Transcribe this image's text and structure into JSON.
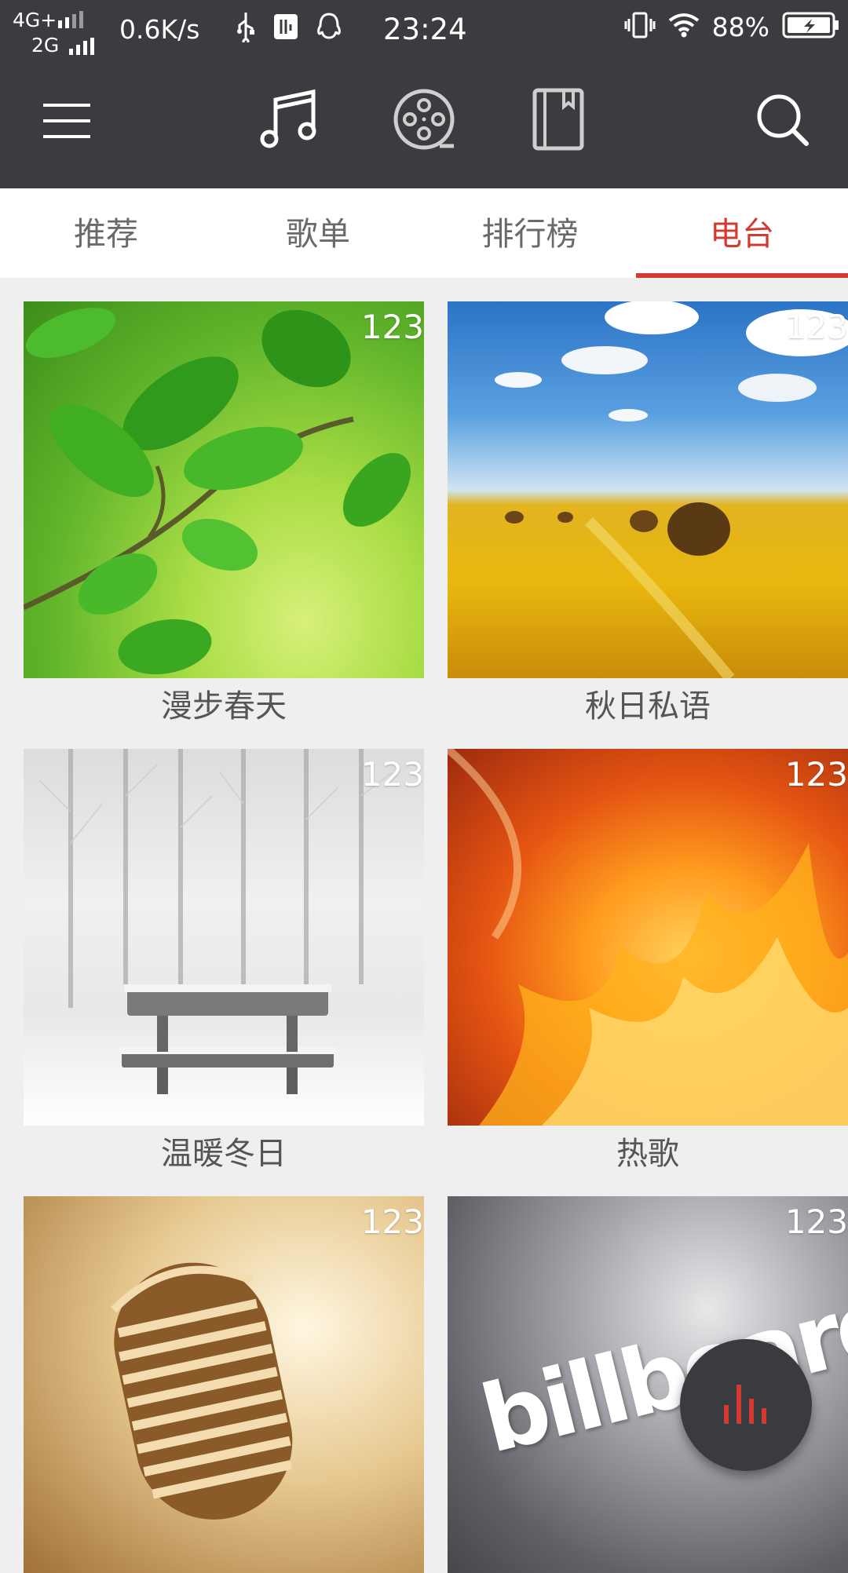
{
  "status_bar": {
    "network_top": "4G+",
    "network_bottom": "2G",
    "speed": "0.6K/s",
    "time": "23:24",
    "battery_percent": "88%",
    "icons": [
      "usb-icon",
      "usb-debug-icon",
      "qq-icon",
      "vibrate-icon",
      "wifi-icon",
      "battery-charging-icon"
    ]
  },
  "toolbar": {
    "icons": [
      "menu-icon",
      "music-note-icon",
      "film-reel-icon",
      "book-icon",
      "search-icon"
    ]
  },
  "tabs": [
    {
      "label": "推荐",
      "active": false
    },
    {
      "label": "歌单",
      "active": false
    },
    {
      "label": "排行榜",
      "active": false
    },
    {
      "label": "电台",
      "active": true
    }
  ],
  "accent_color": "#d33a31",
  "radios": [
    {
      "title": "漫步春天",
      "count": "123"
    },
    {
      "title": "秋日私语",
      "count": "123"
    },
    {
      "title": "温暖冬日",
      "count": "123"
    },
    {
      "title": "热歌",
      "count": "123"
    },
    {
      "title": "",
      "count": "123"
    },
    {
      "title": "",
      "count": "123"
    }
  ],
  "billboard_logo_text": "billboard",
  "fab": {
    "icon": "equalizer-icon"
  }
}
